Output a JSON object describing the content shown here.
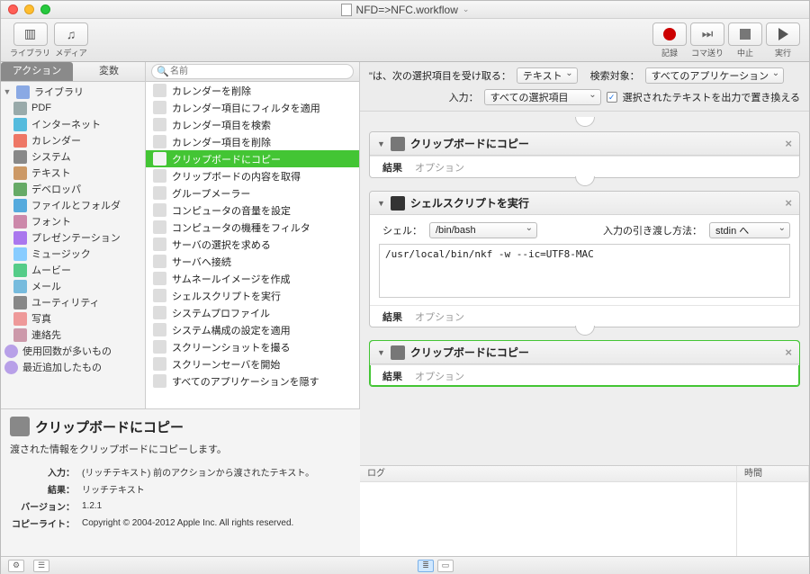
{
  "title": "NFD=>NFC.workflow",
  "toolbar": {
    "library": "ライブラリ",
    "media": "メディア",
    "record": "記録",
    "step": "コマ送り",
    "stop": "中止",
    "run": "実行"
  },
  "tabs": {
    "actions": "アクション",
    "variables": "変数"
  },
  "search_placeholder": "名前",
  "sidebar": {
    "root": "ライブラリ",
    "items": [
      "PDF",
      "インターネット",
      "カレンダー",
      "システム",
      "テキスト",
      "デベロッパ",
      "ファイルとフォルダ",
      "フォント",
      "プレゼンテーション",
      "ミュージック",
      "ムービー",
      "メール",
      "ユーティリティ",
      "写真",
      "連絡先"
    ],
    "smart": [
      "使用回数が多いもの",
      "最近追加したもの"
    ]
  },
  "actions": [
    "カレンダーを削除",
    "カレンダー項目にフィルタを適用",
    "カレンダー項目を検索",
    "カレンダー項目を削除",
    "クリップボードにコピー",
    "クリップボードの内容を取得",
    "グループメーラー",
    "コンピュータの音量を設定",
    "コンピュータの機種をフィルタ",
    "サーバの選択を求める",
    "サーバへ接続",
    "サムネールイメージを作成",
    "シェルスクリプトを実行",
    "システムプロファイル",
    "システム構成の設定を適用",
    "スクリーンショットを撮る",
    "スクリーンセーバを開始",
    "すべてのアプリケーションを隠す"
  ],
  "actions_selected_index": 4,
  "detail": {
    "title": "クリップボードにコピー",
    "desc": "渡された情報をクリップボードにコピーします。",
    "rows": {
      "input_l": "入力：",
      "input_v": "(リッチテキスト) 前のアクションから渡されたテキスト。",
      "result_l": "結果：",
      "result_v": "リッチテキスト",
      "version_l": "バージョン：",
      "version_v": "1.2.1",
      "copyright_l": "コピーライト：",
      "copyright_v": "Copyright © 2004-2012 Apple Inc.  All rights reserved."
    }
  },
  "canvas_header": {
    "receives": "\"は、次の選択項目を受け取る：",
    "receives_value": "テキスト",
    "target_l": "検索対象：",
    "target_v": "すべてのアプリケーション",
    "input_l": "入力：",
    "input_v": "すべての選択項目",
    "replace": "選択されたテキストを出力で置き換える"
  },
  "steps": {
    "copy1_title": "クリップボードにコピー",
    "shell_title": "シェルスクリプトを実行",
    "copy2_title": "クリップボードにコピー",
    "results": "結果",
    "options": "オプション",
    "shell_l": "シェル：",
    "shell_v": "/bin/bash",
    "pass_l": "入力の引き渡し方法：",
    "pass_v": "stdin へ",
    "code": "/usr/local/bin/nkf -w --ic=UTF8-MAC"
  },
  "log": {
    "log_l": "ログ",
    "time_l": "時間"
  }
}
